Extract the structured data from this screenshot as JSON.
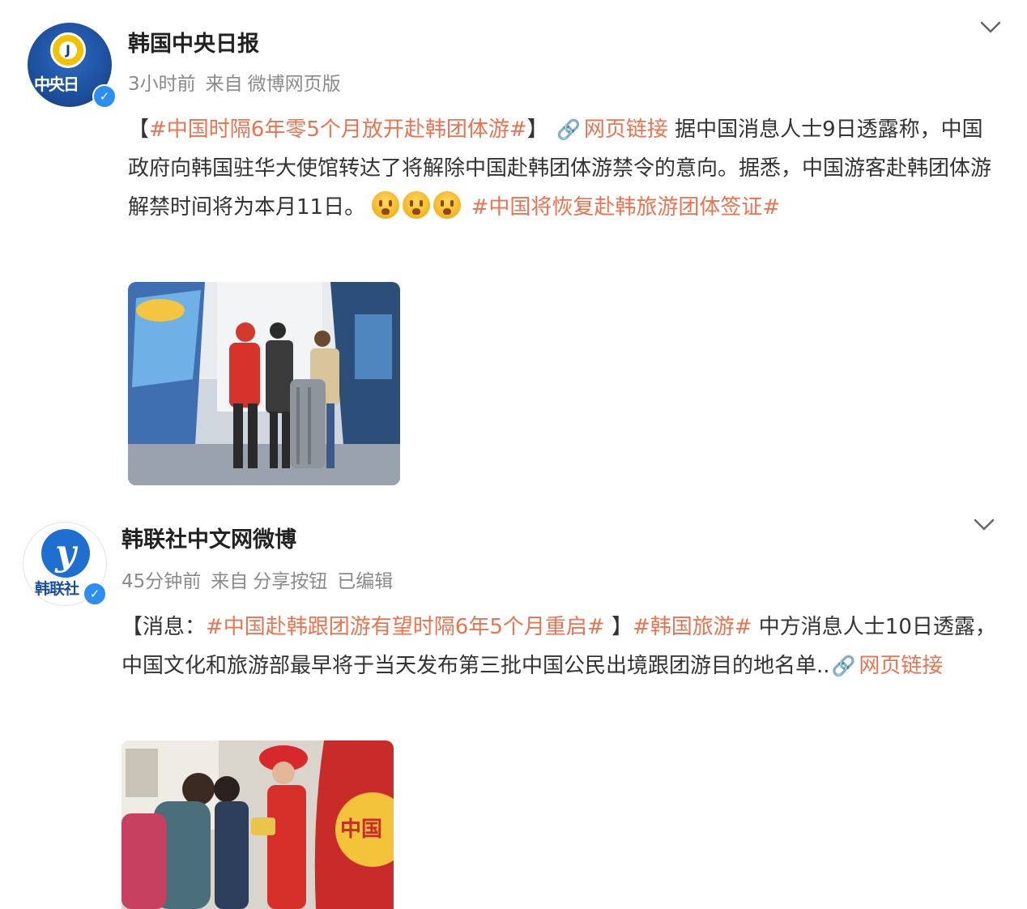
{
  "posts": [
    {
      "author": "韩国中央日报",
      "avatar": {
        "logo_text": "中央日",
        "ring_letter": "J",
        "icon": "joongang-logo"
      },
      "meta": {
        "time": "3小时前",
        "source_prefix": "来自",
        "source": "微博网页版"
      },
      "menu_icon": "chevron-down-icon",
      "verified_icon": "verified-badge-icon",
      "content": {
        "open": "【",
        "tag1": "#中国时隔6年零5个月放开赴韩团体游#",
        "close": "】",
        "link_label": "网页链接",
        "text": "据中国消息人士9日透露称，中国政府向韩国驻华大使馆转达了将解除中国赴韩团体游禁令的意向。据悉，中国游客赴韩团体游解禁时间将为本月11日。",
        "emoji_count": 3,
        "tag2": "#中国将恢复赴韩旅游团体签证#"
      },
      "image": {
        "description_icon": "photo-tourists-luggage"
      }
    },
    {
      "author": "韩联社中文网微博",
      "avatar": {
        "logo_text": "韩联社",
        "ring_letter": "y",
        "icon": "yonhap-logo"
      },
      "meta": {
        "time": "45分钟前",
        "source_prefix": "来自",
        "source": "分享按钮",
        "edited": "已编辑"
      },
      "menu_icon": "chevron-down-icon",
      "verified_icon": "verified-badge-icon",
      "content": {
        "open": "【消息：",
        "tag1": "#中国赴韩跟团游有望时隔6年5个月重启#",
        "close": "】",
        "tag2": "#韩国旅游#",
        "text": "中方消息人士10日透露，中国文化和旅游部最早将于当天发布第三批中国公民出境跟团游目的地名单..",
        "link_label": "网页链接"
      },
      "image": {
        "description_icon": "photo-tour-guide-group",
        "vest_text": "中国"
      }
    }
  ],
  "colors": {
    "link": "#eb7350",
    "meta": "#8a8a8a",
    "verified": "#2c8ef0"
  }
}
